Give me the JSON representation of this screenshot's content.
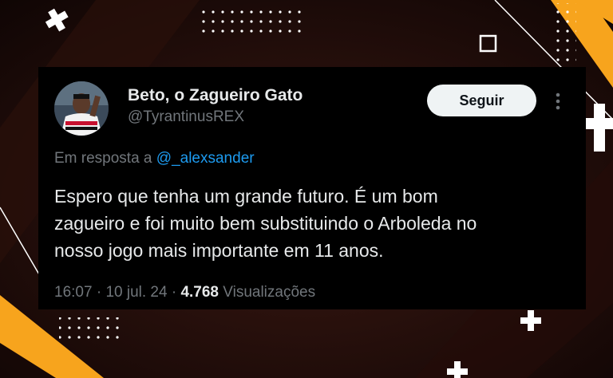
{
  "theme": {
    "accent": "#1d9bf0",
    "card_bg": "#000000",
    "text_primary": "#e7e9ea",
    "text_secondary": "#71767b",
    "bg_orange": "#f7a41d"
  },
  "tweet": {
    "author": {
      "display_name": "Beto, o Zagueiro Gato",
      "handle": "@TyrantinusREX",
      "avatar_icon": "avatar-photo"
    },
    "follow_label": "Seguir",
    "more_icon": "more-vertical-icon",
    "reply": {
      "prefix": "Em resposta a",
      "mention": "@_alexsander"
    },
    "text_lines": [
      "Espero que tenha um grande futuro. É um bom",
      "zagueiro e foi muito bem substituindo o Arboleda no",
      "nosso jogo mais importante em 11 anos."
    ],
    "time": "16:07",
    "date": "10 jul. 24",
    "views_count": "4.768",
    "views_label": "Visualizações"
  }
}
